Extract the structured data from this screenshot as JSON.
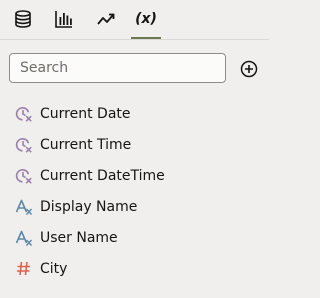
{
  "tabs": [
    {
      "name": "database-icon",
      "active": false
    },
    {
      "name": "bar-chart-icon",
      "active": false
    },
    {
      "name": "trend-icon",
      "active": false
    },
    {
      "name": "formula-icon",
      "label": "(x)",
      "active": true
    }
  ],
  "search": {
    "placeholder": "Search",
    "value": ""
  },
  "add_button": {
    "icon": "plus-circle-icon"
  },
  "items": [
    {
      "label": "Current Date",
      "icon": "clock-function-icon"
    },
    {
      "label": "Current Time",
      "icon": "clock-function-icon"
    },
    {
      "label": "Current DateTime",
      "icon": "clock-function-icon"
    },
    {
      "label": "Display Name",
      "icon": "text-function-icon"
    },
    {
      "label": "User Name",
      "icon": "text-function-icon"
    },
    {
      "label": "City",
      "icon": "number-parameter-icon"
    }
  ],
  "colors": {
    "accent": "#6b7a55",
    "clock_icon": "#9a7faa",
    "text_icon": "#5d8aa8",
    "number_icon": "#d9634f"
  }
}
